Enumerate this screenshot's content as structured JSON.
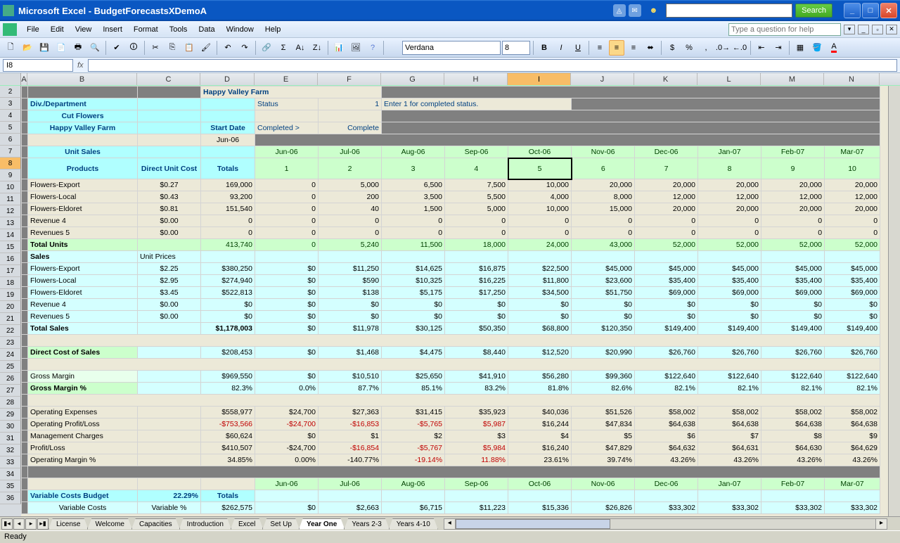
{
  "titlebar": {
    "app": "Microsoft Excel",
    "doc": "BudgetForecastsXDemoA",
    "search_btn": "Search"
  },
  "menubar": {
    "file": "File",
    "edit": "Edit",
    "view": "View",
    "insert": "Insert",
    "format": "Format",
    "tools": "Tools",
    "data": "Data",
    "window": "Window",
    "help": "Help",
    "helpbox": "Type a question for help"
  },
  "toolbar": {
    "font": "Verdana",
    "size": "8"
  },
  "formulabar": {
    "namebox": "I8",
    "fx": "fx"
  },
  "columns": [
    "A",
    "B",
    "C",
    "D",
    "E",
    "F",
    "G",
    "H",
    "I",
    "J",
    "K",
    "L",
    "M",
    "N"
  ],
  "rows_shown": [
    "2",
    "3",
    "4",
    "5",
    "6",
    "7",
    "8",
    "9",
    "10",
    "11",
    "12",
    "13",
    "14",
    "15",
    "16",
    "17",
    "18",
    "19",
    "20",
    "21",
    "22",
    "23",
    "24",
    "25",
    "26",
    "27",
    "28",
    "29",
    "30",
    "31",
    "32",
    "33",
    "34",
    "35",
    "36"
  ],
  "sheet": {
    "company": "Happy Valley Farm",
    "div_label": "Div./Department",
    "status_label": "Status",
    "status_val": "1",
    "status_note": "Enter 1 for completed status.",
    "dept": "Cut Flowers",
    "farm": "Happy Valley Farm",
    "startdate_label": "Start Date",
    "completed_arrow": "Completed >",
    "complete": "Complete",
    "startdate": "Jun-06",
    "unit_sales": "Unit Sales",
    "direct_unit_cost": "Direct Unit Cost",
    "totals": "Totals",
    "products": "Products",
    "months": [
      "Jun-06",
      "Jul-06",
      "Aug-06",
      "Sep-06",
      "Oct-06",
      "Nov-06",
      "Dec-06",
      "Jan-07",
      "Feb-07",
      "Mar-07"
    ],
    "period_nums": [
      "1",
      "2",
      "3",
      "4",
      "5",
      "6",
      "7",
      "8",
      "9",
      "10"
    ],
    "rows": {
      "fe": {
        "label": "Flowers-Export",
        "cost": "$0.27",
        "total": "169,000",
        "m": [
          "0",
          "5,000",
          "6,500",
          "7,500",
          "10,000",
          "20,000",
          "20,000",
          "20,000",
          "20,000",
          "20,000"
        ]
      },
      "fl": {
        "label": "Flowers-Local",
        "cost": "$0.43",
        "total": "93,200",
        "m": [
          "0",
          "200",
          "3,500",
          "5,500",
          "4,000",
          "8,000",
          "12,000",
          "12,000",
          "12,000",
          "12,000"
        ]
      },
      "fd": {
        "label": "Flowers-Eldoret",
        "cost": "$0.81",
        "total": "151,540",
        "m": [
          "0",
          "40",
          "1,500",
          "5,000",
          "10,000",
          "15,000",
          "20,000",
          "20,000",
          "20,000",
          "20,000"
        ]
      },
      "r4": {
        "label": "Revenue 4",
        "cost": "$0.00",
        "total": "0",
        "m": [
          "0",
          "0",
          "0",
          "0",
          "0",
          "0",
          "0",
          "0",
          "0",
          "0"
        ]
      },
      "r5": {
        "label": "Revenues 5",
        "cost": "$0.00",
        "total": "0",
        "m": [
          "0",
          "0",
          "0",
          "0",
          "0",
          "0",
          "0",
          "0",
          "0",
          "0"
        ]
      }
    },
    "total_units": {
      "label": "Total Units",
      "total": "413,740",
      "m": [
        "0",
        "5,240",
        "11,500",
        "18,000",
        "24,000",
        "43,000",
        "52,000",
        "52,000",
        "52,000",
        "52,000"
      ]
    },
    "sales_label": "Sales",
    "unit_prices": "Unit Prices",
    "salesrows": {
      "fe": {
        "label": "Flowers-Export",
        "price": "$2.25",
        "total": "$380,250",
        "m": [
          "$0",
          "$11,250",
          "$14,625",
          "$16,875",
          "$22,500",
          "$45,000",
          "$45,000",
          "$45,000",
          "$45,000",
          "$45,000"
        ]
      },
      "fl": {
        "label": "Flowers-Local",
        "price": "$2.95",
        "total": "$274,940",
        "m": [
          "$0",
          "$590",
          "$10,325",
          "$16,225",
          "$11,800",
          "$23,600",
          "$35,400",
          "$35,400",
          "$35,400",
          "$35,400"
        ]
      },
      "fd": {
        "label": "Flowers-Eldoret",
        "price": "$3.45",
        "total": "$522,813",
        "m": [
          "$0",
          "$138",
          "$5,175",
          "$17,250",
          "$34,500",
          "$51,750",
          "$69,000",
          "$69,000",
          "$69,000",
          "$69,000"
        ]
      },
      "r4": {
        "label": "Revenue 4",
        "price": "$0.00",
        "total": "$0",
        "m": [
          "$0",
          "$0",
          "$0",
          "$0",
          "$0",
          "$0",
          "$0",
          "$0",
          "$0",
          "$0"
        ]
      },
      "r5": {
        "label": "Revenues 5",
        "price": "$0.00",
        "total": "$0",
        "m": [
          "$0",
          "$0",
          "$0",
          "$0",
          "$0",
          "$0",
          "$0",
          "$0",
          "$0",
          "$0"
        ]
      }
    },
    "total_sales": {
      "label": "Total Sales",
      "total": "$1,178,003",
      "m": [
        "$0",
        "$11,978",
        "$30,125",
        "$50,350",
        "$68,800",
        "$120,350",
        "$149,400",
        "$149,400",
        "$149,400",
        "$149,400"
      ]
    },
    "direct_cost": {
      "label": "Direct Cost of Sales",
      "total": "$208,453",
      "m": [
        "$0",
        "$1,468",
        "$4,475",
        "$8,440",
        "$12,520",
        "$20,990",
        "$26,760",
        "$26,760",
        "$26,760",
        "$26,760"
      ]
    },
    "gross_margin": {
      "label": "Gross Margin",
      "total": "$969,550",
      "m": [
        "$0",
        "$10,510",
        "$25,650",
        "$41,910",
        "$56,280",
        "$99,360",
        "$122,640",
        "$122,640",
        "$122,640",
        "$122,640"
      ]
    },
    "gross_margin_pct": {
      "label": "Gross Margin %",
      "total": "82.3%",
      "m": [
        "0.0%",
        "87.7%",
        "85.1%",
        "83.2%",
        "81.8%",
        "82.6%",
        "82.1%",
        "82.1%",
        "82.1%",
        "82.1%"
      ]
    },
    "opex": {
      "label": "Operating Expenses",
      "total": "$558,977",
      "m": [
        "$24,700",
        "$27,363",
        "$31,415",
        "$35,923",
        "$40,036",
        "$51,526",
        "$58,002",
        "$58,002",
        "$58,002",
        "$58,002"
      ]
    },
    "opl": {
      "label": "Operating Profit/Loss",
      "total": "-$753,566",
      "m": [
        "-$24,700",
        "-$16,853",
        "-$5,765",
        "$5,987",
        "$16,244",
        "$47,834",
        "$64,638",
        "$64,638",
        "$64,638",
        "$64,638"
      ],
      "neg": [
        true,
        true,
        true,
        true,
        false,
        false,
        false,
        false,
        false,
        false
      ]
    },
    "mgmt": {
      "label": "Management Charges",
      "total": "$60,624",
      "m": [
        "$0",
        "$1",
        "$2",
        "$3",
        "$4",
        "$5",
        "$6",
        "$7",
        "$8",
        "$9"
      ]
    },
    "pl": {
      "label": "Profit/Loss",
      "total": "$410,507",
      "m": [
        "-$24,700",
        "-$16,854",
        "-$5,767",
        "$5,984",
        "$16,240",
        "$47,829",
        "$64,632",
        "$64,631",
        "$64,630",
        "$64,629"
      ],
      "neg": [
        false,
        true,
        true,
        true,
        false,
        false,
        false,
        false,
        false,
        false
      ]
    },
    "opmargin": {
      "label": "Operating Margin %",
      "total": "34.85%",
      "m": [
        "0.00%",
        "-140.77%",
        "-19.14%",
        "11.88%",
        "23.61%",
        "39.74%",
        "43.26%",
        "43.26%",
        "43.26%",
        "43.26%"
      ],
      "neg": [
        false,
        false,
        true,
        true,
        false,
        false,
        false,
        false,
        false,
        false
      ]
    },
    "varcost_label": "Variable Costs Budget",
    "varcost_pct": "22.29%",
    "var_label": "Variable Costs",
    "var_pct_label": "Variable %",
    "var_total": "$262,575",
    "var_m": [
      "$0",
      "$2,663",
      "$6,715",
      "$11,223",
      "$15,336",
      "$26,826",
      "$33,302",
      "$33,302",
      "$33,302",
      "$33,302"
    ]
  },
  "tabs": {
    "list": [
      "License",
      "Welcome",
      "Capacities",
      "Introduction",
      "Excel",
      "Set Up",
      "Year One",
      "Years 2-3",
      "Years 4-10"
    ],
    "active": "Year One"
  },
  "status": "Ready"
}
